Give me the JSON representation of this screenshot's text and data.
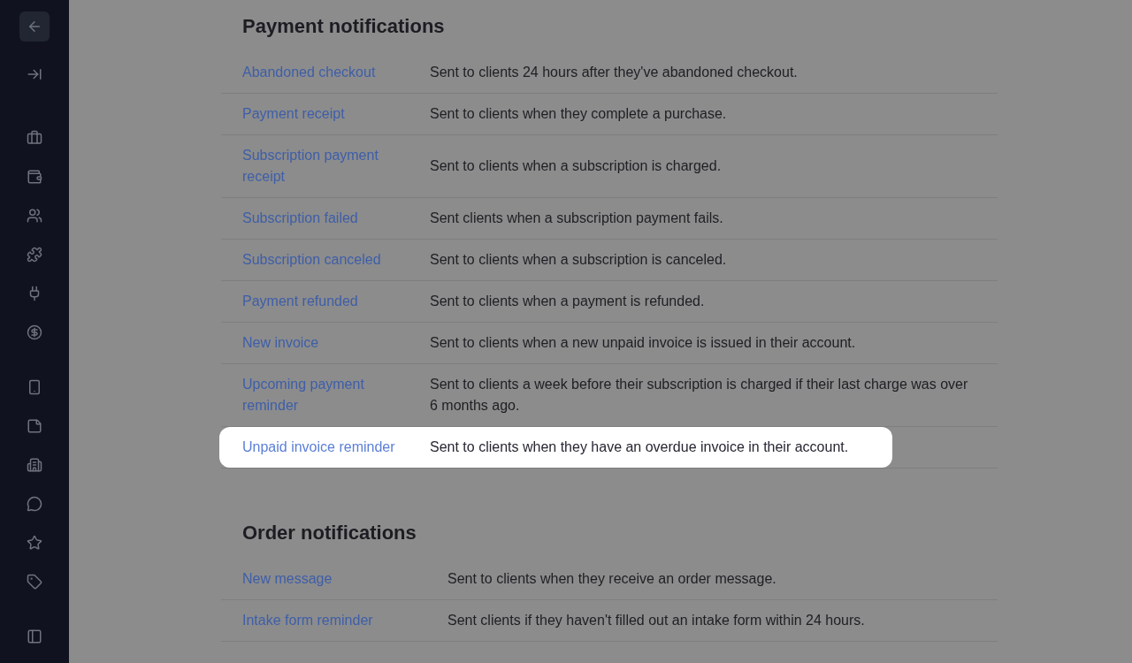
{
  "sections": [
    {
      "kind": "payment",
      "title": "Payment notifications",
      "rows": [
        {
          "name": "Abandoned checkout",
          "description": "Sent to clients 24 hours after they've abandoned checkout.",
          "highlighted": false
        },
        {
          "name": "Payment receipt",
          "description": "Sent to clients when they complete a purchase.",
          "highlighted": false
        },
        {
          "name": "Subscription payment receipt",
          "description": "Sent to clients when a subscription is charged.",
          "highlighted": false
        },
        {
          "name": "Subscription failed",
          "description": "Sent clients when a subscription payment fails.",
          "highlighted": false
        },
        {
          "name": "Subscription canceled",
          "description": "Sent to clients when a subscription is canceled.",
          "highlighted": false
        },
        {
          "name": "Payment refunded",
          "description": "Sent to clients when a payment is refunded.",
          "highlighted": false
        },
        {
          "name": "New invoice",
          "description": "Sent to clients when a new unpaid invoice is issued in their account.",
          "highlighted": false
        },
        {
          "name": "Upcoming payment reminder",
          "description": "Sent to clients a week before their subscription is charged if their last charge was over 6 months ago.",
          "highlighted": false
        },
        {
          "name": "Unpaid invoice reminder",
          "description": "Sent to clients when they have an overdue invoice in their account.",
          "highlighted": true
        }
      ]
    },
    {
      "kind": "order",
      "title": "Order notifications",
      "rows": [
        {
          "name": "New message",
          "description": "Sent to clients when they receive an order message.",
          "highlighted": false
        },
        {
          "name": "Intake form reminder",
          "description": "Sent clients if they haven't filled out an intake form within 24 hours.",
          "highlighted": false
        }
      ]
    }
  ]
}
